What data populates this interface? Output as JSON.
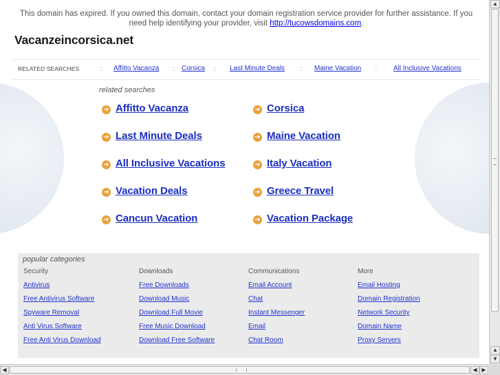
{
  "notice": {
    "text": "This domain has expired. If you owned this domain, contact your domain registration service provider for further assistance. If you need help identifying your provider, visit ",
    "link": "http://tucowsdomains.com",
    "end": "."
  },
  "site_title": "Vacanzeincorsica.net",
  "related_bar": {
    "label": "RELATED SEARCHES",
    "separator": "::",
    "links": [
      "Affitto Vacanza",
      "Corsica",
      "Last Minute Deals",
      "Maine Vacation",
      "All Inclusive Vacations"
    ]
  },
  "related": {
    "heading": "related searches",
    "arrow_glyph": "➔",
    "left": [
      "Affitto Vacanza",
      "Last Minute Deals",
      "All Inclusive Vacations",
      "Vacation Deals",
      "Cancun Vacation"
    ],
    "right": [
      "Corsica",
      "Maine Vacation",
      "Italy Vacation",
      "Greece Travel",
      "Vacation Package"
    ]
  },
  "popular": {
    "heading": "popular categories",
    "columns": [
      {
        "title": "Security",
        "links": [
          "Antivirus",
          "Free Antivirus Software",
          "Spyware Removal",
          "Anti Virus Software",
          "Free Anti Virus Download"
        ]
      },
      {
        "title": "Downloads",
        "links": [
          "Free Downloads",
          "Download Music",
          "Download Full Movie",
          "Free Music Download",
          "Download Free Software"
        ]
      },
      {
        "title": "Communications",
        "links": [
          "Email Account",
          "Chat",
          "Instant Messenger",
          "Email",
          "Chat Room"
        ]
      },
      {
        "title": "More",
        "links": [
          "Email Hosting",
          "Domain Registration",
          "Network Security",
          "Domain Name",
          "Proxy Servers"
        ]
      }
    ]
  },
  "scrollbar_glyphs": {
    "up": "▲",
    "down": "▼",
    "left": "◀",
    "right": "▶"
  },
  "colors": {
    "link": "#1a2fbf",
    "arrow": "#e8a23a",
    "panel": "#ebebeb"
  }
}
